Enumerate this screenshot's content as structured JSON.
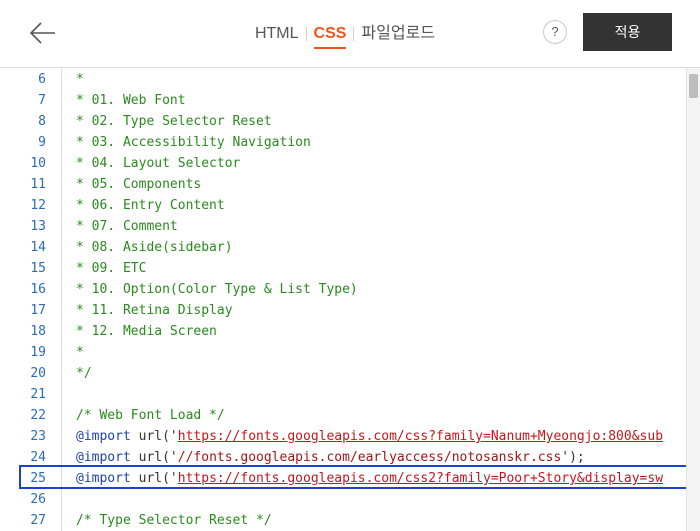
{
  "header": {
    "back_icon": "arrow-left-icon",
    "tabs": [
      {
        "label": "HTML",
        "active": false
      },
      {
        "label": "CSS",
        "active": true
      },
      {
        "label": "파일업로드",
        "active": false
      }
    ],
    "help_label": "?",
    "apply_label": "적용"
  },
  "colors": {
    "accent": "#f2541e",
    "apply_bg": "#333333",
    "line_number": "#2b6cb8",
    "comment": "#2a8a1e",
    "at_rule": "#1f44a8",
    "url": "#c4161c",
    "highlight_border": "#1a3fd6"
  },
  "editor": {
    "highlighted_line": "25",
    "lines": [
      {
        "num": "6",
        "code": "*"
      },
      {
        "num": "7",
        "code": "* 01. Web Font"
      },
      {
        "num": "8",
        "code": "* 02. Type Selector Reset"
      },
      {
        "num": "9",
        "code": "* 03. Accessibility Navigation"
      },
      {
        "num": "10",
        "code": "* 04. Layout Selector"
      },
      {
        "num": "11",
        "code": "* 05. Components"
      },
      {
        "num": "12",
        "code": "* 06. Entry Content"
      },
      {
        "num": "13",
        "code": "* 07. Comment"
      },
      {
        "num": "14",
        "code": "* 08. Aside(sidebar)"
      },
      {
        "num": "15",
        "code": "* 09. ETC"
      },
      {
        "num": "16",
        "code": "* 10. Option(Color Type & List Type)"
      },
      {
        "num": "17",
        "code": "* 11. Retina Display"
      },
      {
        "num": "18",
        "code": "* 12. Media Screen"
      },
      {
        "num": "19",
        "code": "*"
      },
      {
        "num": "20",
        "code": "*/"
      },
      {
        "num": "21",
        "code": ""
      },
      {
        "num": "22",
        "code": "/* Web Font Load */"
      },
      {
        "num": "23",
        "at": "@import",
        "fn": " url('",
        "url": "https://fonts.googleapis.com/css?family=Nanum+Myeongjo:800&sub",
        "end": ""
      },
      {
        "num": "24",
        "at": "@import",
        "fn": " url('",
        "str": "//fonts.googleapis.com/earlyaccess/notosanskr.css",
        "end": "');"
      },
      {
        "num": "25",
        "at": "@import",
        "fn": " url('",
        "url": "https://fonts.googleapis.com/css2?family=Poor+Story&display=sw",
        "end": ""
      },
      {
        "num": "26",
        "code": ""
      },
      {
        "num": "27",
        "code": "/* Type Selector Reset */"
      }
    ]
  }
}
